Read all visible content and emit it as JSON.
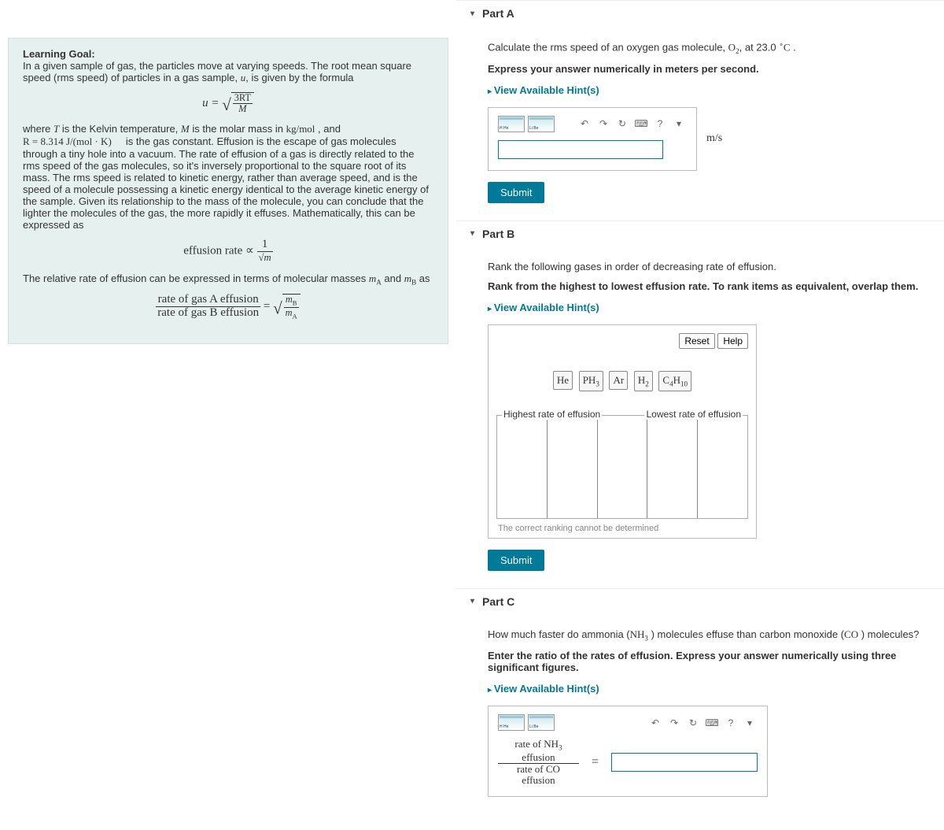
{
  "learning": {
    "heading": "Learning Goal:",
    "intro": "In a given sample of gas, the particles move at varying speeds. The root mean square speed (rms speed) of particles in a gas sample, ",
    "intro2": ", is given by the formula",
    "u": "u",
    "eq": "u =",
    "numer": "3RT",
    "denom": "M",
    "where1": "where ",
    "T": "T",
    "where2": " is the Kelvin temperature, ",
    "M": "M",
    "where3": " is the molar mass in ",
    "molarunits": "kg/mol",
    "where4": " , and ",
    "R": "R = 8.314 J/(mol · K)",
    "where5": " is the gas constant. Effusion is the escape of gas molecules through a tiny hole into a vacuum. The rate of effusion of a gas is directly related to the rms speed of the gas molecules, so it's inversely proportional to the square root of its mass. The rms speed is related to kinetic energy, rather than average speed, and is the speed of a molecule possessing a kinetic energy identical to the average kinetic energy of the sample. Given its relationship to the mass of the molecule, you can conclude that the lighter the molecules of the gas, the more rapidly it effuses. Mathematically, this can be expressed as",
    "eff_label": "effusion rate ∝",
    "eff_numer": "1",
    "eff_denom": "m",
    "rel_intro1": "The relative rate of effusion can be expressed in terms of molecular masses ",
    "mA": "m",
    "mAsub": "A",
    "rel_intro2": " and ",
    "mB": "m",
    "mBsub": "B",
    "rel_intro3": " as",
    "ratioA": "rate of gas A effusion",
    "ratioB": "rate of gas B effusion",
    "ratio_numer_m": "m",
    "ratio_numer_sub": "B",
    "ratio_denom_m": "m",
    "ratio_denom_sub": "A"
  },
  "partA": {
    "title": "Part A",
    "q1": "Calculate the rms speed of an oxygen gas molecule, ",
    "o2": "O",
    "o2sub": "2",
    "q2": ", at 23.0 ",
    "deg": "∘",
    "degC": "C",
    "q3": " .",
    "instruct": "Express your answer numerically in meters per second.",
    "hint": "View Available Hint(s)",
    "unit": "m/s",
    "submit": "Submit"
  },
  "partB": {
    "title": "Part B",
    "q": "Rank the following gases in order of decreasing rate of effusion.",
    "instruct": "Rank from the highest to lowest effusion rate. To rank items as equivalent, overlap them.",
    "hint": "View Available Hint(s)",
    "reset": "Reset",
    "help": "Help",
    "gases": [
      {
        "f": "He",
        "s": ""
      },
      {
        "f": "PH",
        "s": "3"
      },
      {
        "f": "Ar",
        "s": ""
      },
      {
        "f": "H",
        "s": "2"
      },
      {
        "f": "C",
        "s": "4",
        "f2": "H",
        "s2": "10"
      }
    ],
    "left": "Highest rate of effusion",
    "right": "Lowest rate of effusion",
    "note": "The correct ranking cannot be determined",
    "submit": "Submit"
  },
  "partC": {
    "title": "Part C",
    "q1": "How much faster do ammonia (",
    "nh3": "NH",
    "nh3sub": "3",
    "q2": " ) molecules effuse than carbon monoxide (",
    "co": "CO",
    "q3": " ) molecules?",
    "instruct": "Enter the ratio of the rates of effusion. Express your answer numerically using three significant figures.",
    "hint": "View Available Hint(s)",
    "ratio_top1": "rate of ",
    "ratio_top_nh3": "NH",
    "ratio_top_nh3sub": "3",
    "ratio_top2": " effusion",
    "ratio_bot1": "rate of ",
    "ratio_bot_co": "CO",
    "ratio_bot2": " effusion",
    "eq": "="
  },
  "toolbar": {
    "pt1": "H He",
    "pt2": "Li Be",
    "undo": "↶",
    "redo": "↷",
    "reset": "↻",
    "keyb": "⌨",
    "help": "?",
    "more": "▾"
  }
}
